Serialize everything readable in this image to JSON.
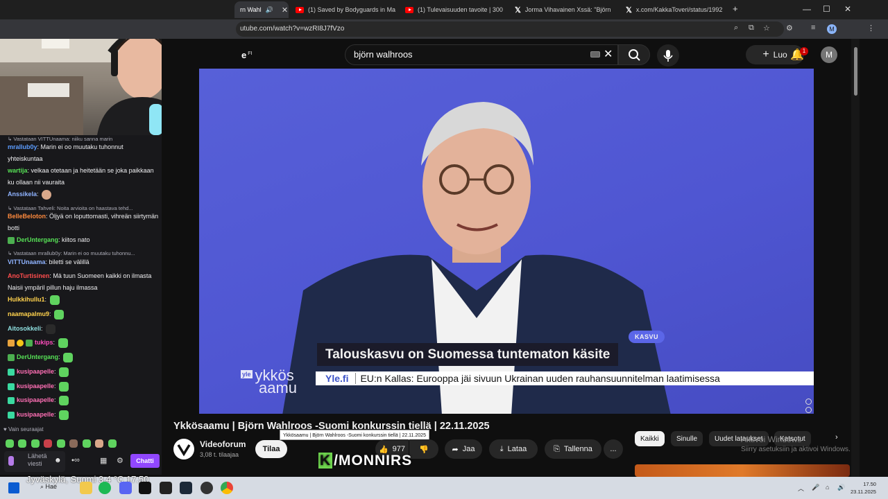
{
  "browser": {
    "tabs": [
      {
        "title": "rn Wahl",
        "active": true,
        "icon": "speaker-icon"
      },
      {
        "title": "(1) Saved by Bodyguards in Ma",
        "icon": "youtube-icon"
      },
      {
        "title": "(1) Tulevaisuuden tavoite | 300",
        "icon": "youtube-icon"
      },
      {
        "title": "Jorma Vihavainen Xssä: \"Björn",
        "icon": "x-icon"
      },
      {
        "title": "x.com/KakkaToveri/status/1992",
        "icon": "x-icon"
      }
    ],
    "new_tab": "+",
    "url": "utube.com/watch?v=wzRI8J7fVzo",
    "profile_initial": "M"
  },
  "youtube": {
    "logo_suffix": "e",
    "logo_region": "FI",
    "search_query": "björn walhroos",
    "create_label": "Luo",
    "notification_count": "1",
    "avatar_initial": "M",
    "video": {
      "tag": "KASVU",
      "headline": "Talouskasvu on Suomessa tuntematon käsite",
      "ticker_source": "Yle.fi",
      "ticker_text": "EU:n Kallas: Eurooppa jäi sivuun Ukrainan uuden rauhansuunnitelman laatimisessa",
      "show_logo": "ykkös",
      "show_logo_2": "aamu",
      "show_logo_prefix": "yle"
    },
    "title": "Ykkösaamu | Björn Wahlroos -Suomi konkurssin tiellä | 22.11.2025",
    "tooltip": "Ykkösaamu | Björn Wahlroos -Suomi konkurssin tiellä | 22.11.2025",
    "channel": {
      "name": "Videoforum",
      "subscribers": "3,08 t. tilaajaa"
    },
    "subscribe_label": "Tilaa",
    "actions": {
      "likes": "977",
      "share": "Jaa",
      "download": "Lataa",
      "save": "Tallenna",
      "more": "..."
    },
    "chips": [
      "Kaikki",
      "Sinulle",
      "Uudet lataukset",
      "Katsotut"
    ],
    "watermark": "/MONNIRS",
    "watermark_k": "K",
    "windows_activation": {
      "line1": "Aktivoi Windows",
      "line2": "Siirry asetuksiin ja aktivoi Windows."
    }
  },
  "chat": {
    "messages": [
      {
        "reply": "Vastataan VITTUnaama: niiku sanna marin"
      },
      {
        "user": "mrallub0y",
        "color": "#5c9dff",
        "text": "Marin ei oo muutaku tuhonnut yhteiskuntaa"
      },
      {
        "user": "wartija",
        "color": "#56e056",
        "text": "velkaa otetaan ja heitetään se joka paikkaan ku ollaan nii vauraita"
      },
      {
        "user": "Anssikela",
        "color": "#8fb3ff",
        "text": ""
      },
      {
        "reply": "Vastataan Tahveli: Noita arvioita on haastava tehd..."
      },
      {
        "user": "BelleBeloton",
        "color": "#ff8a3d",
        "text": "Öljyä on loputtomasti, vihreän siirtymän botti"
      },
      {
        "user": "DerUntergang",
        "color": "#56e056",
        "text": "kiitos nato"
      },
      {
        "reply": "Vastataan mrallub0y: Marin ei oo muutaku tuhonnu..."
      },
      {
        "user": "VITTUnaama",
        "color": "#8fb3ff",
        "text": "biletti se välillä"
      },
      {
        "user": "AnoTurtisinen",
        "color": "#ff4d4d",
        "text": "Mä tuun Suomeen kaikki on ilmasta Naisii ympäril pillun haju ilmassa"
      },
      {
        "user": "Hulkkihullu1",
        "color": "#ffd24d",
        "text": ""
      },
      {
        "user": "naamapalmu9",
        "color": "#ffd24d",
        "text": ""
      },
      {
        "user": "Aitosokkeli",
        "color": "#8fe0e0",
        "text": ""
      },
      {
        "user": "tukips",
        "color": "#ff4dbd",
        "text": ""
      },
      {
        "user": "DerUntergang",
        "color": "#56e056",
        "text": ""
      },
      {
        "user": "kusipaapelle",
        "color": "#ff6fb5",
        "text": ""
      },
      {
        "user": "kusipaapelle",
        "color": "#ff6fb5",
        "text": ""
      },
      {
        "user": "kusipaapelle",
        "color": "#ff6fb5",
        "text": ""
      },
      {
        "user": "kusipaapelle",
        "color": "#ff6fb5",
        "text": ""
      }
    ],
    "mode": "Vain seuraajat",
    "input_placeholder": "Lähetä viesti",
    "chat_button": "Chatti"
  },
  "taskbar": {
    "weather": "Jyväskylä, Suomi   3,4 °C       17.50",
    "search": "Hae",
    "time": "17.50",
    "date": "23.11.2025"
  },
  "colors": {
    "accent": "#9147ff",
    "yt_red": "#ff0000",
    "player_bg": "#5158d4"
  }
}
